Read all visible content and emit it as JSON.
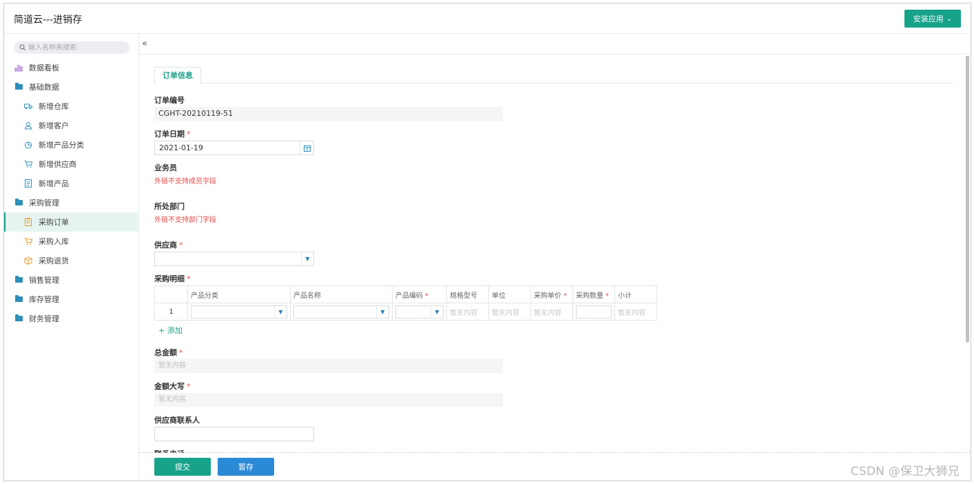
{
  "app": {
    "title": "简道云---进销存",
    "install_label": "安装应用"
  },
  "sidebar": {
    "search_placeholder": "输入名称来搜索",
    "items": [
      {
        "label": "数据看板",
        "icon": "bar-chart-icon",
        "level": 1
      },
      {
        "label": "基础数据",
        "icon": "folder-icon",
        "level": 1
      },
      {
        "label": "新增仓库",
        "icon": "truck-icon",
        "level": 2
      },
      {
        "label": "新增客户",
        "icon": "user-icon",
        "level": 2
      },
      {
        "label": "新增产品分类",
        "icon": "pie-icon",
        "level": 2
      },
      {
        "label": "新增供应商",
        "icon": "cart-icon",
        "level": 2
      },
      {
        "label": "新增产品",
        "icon": "doc-icon",
        "level": 2
      },
      {
        "label": "采购管理",
        "icon": "folder-icon",
        "level": 1
      },
      {
        "label": "采购订单",
        "icon": "order-icon",
        "level": 2,
        "active": true
      },
      {
        "label": "采购入库",
        "icon": "cart-icon",
        "level": 2
      },
      {
        "label": "采购退货",
        "icon": "box-icon",
        "level": 2
      },
      {
        "label": "销售管理",
        "icon": "folder-icon",
        "level": 1
      },
      {
        "label": "库存管理",
        "icon": "folder-icon",
        "level": 1
      },
      {
        "label": "财务管理",
        "icon": "folder-icon",
        "level": 1
      }
    ]
  },
  "form": {
    "tab": "订单信息",
    "order_no": {
      "label": "订单编号",
      "value": "CGHT-20210119-51"
    },
    "order_date": {
      "label": "订单日期",
      "value": "2021-01-19"
    },
    "salesman": {
      "label": "业务员",
      "warning": "外链不支持成员字段"
    },
    "department": {
      "label": "所处部门",
      "warning": "外链不支持部门字段"
    },
    "supplier": {
      "label": "供应商",
      "value": ""
    },
    "detail": {
      "label": "采购明细",
      "columns": [
        "产品分类",
        "产品名称",
        "产品编码",
        "规格型号",
        "单位",
        "采购单价",
        "采购数量",
        "小计"
      ],
      "required_columns": [
        "产品编码",
        "采购单价",
        "采购数量"
      ],
      "row_index": "1",
      "empty_text": "暂无内容",
      "add_label": "+ 添加"
    },
    "total": {
      "label": "总金额",
      "value": "暂无内容"
    },
    "total_upper": {
      "label": "金额大写",
      "value": "暂无内容"
    },
    "contact": {
      "label": "供应商联系人",
      "value": ""
    },
    "phone": {
      "label": "联系电话"
    },
    "required_mark": "*"
  },
  "footer": {
    "submit_label": "提交",
    "draft_label": "暂存"
  },
  "watermark": "CSDN @保卫大狮兄",
  "colors": {
    "accent": "#17a28a",
    "draft": "#2b8ad6",
    "required": "#e24a4a"
  }
}
